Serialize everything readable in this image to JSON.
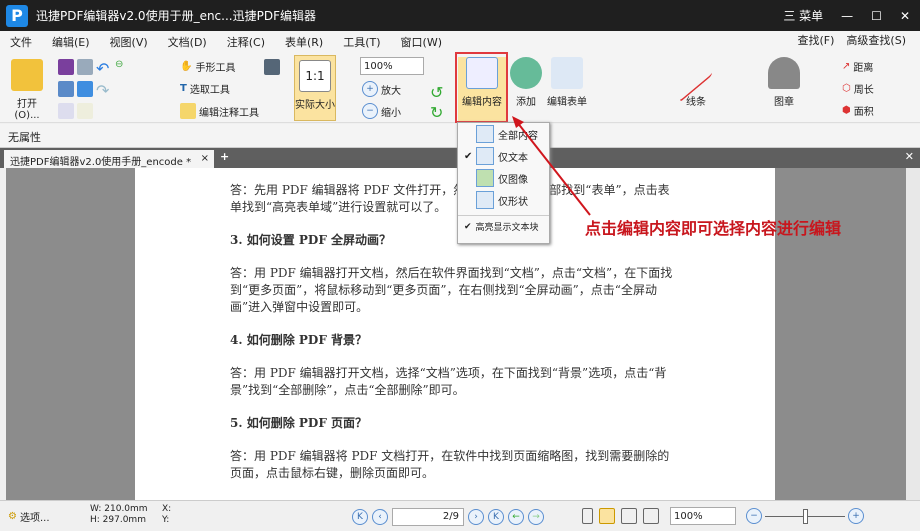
{
  "title": {
    "logo": "P",
    "text": "迅捷PDF编辑器v2.0使用于册_enc...迅捷PDF编辑器",
    "menu": "三 菜单",
    "minimize": "—",
    "maximize": "☐",
    "close": "✕"
  },
  "menubar": [
    "文件",
    "编辑(E)",
    "视图(V)",
    "文档(D)",
    "注释(C)",
    "表单(R)",
    "工具(T)",
    "窗口(W)"
  ],
  "search": {
    "find": "查找(F)",
    "advanced": "高级查找(S)"
  },
  "toolbar": {
    "open": "打开(O)...",
    "hand": "手形工具",
    "select": "选取工具",
    "annot": "编辑注释工具",
    "actual": "实际大小",
    "zoom": "100%",
    "zoom_in": "放大",
    "zoom_out": "缩小",
    "edit_content": "编辑内容",
    "add": "添加",
    "edit_form": "编辑表单",
    "lines": "线条",
    "stamp": "图章",
    "distance": "距离",
    "perimeter": "周长",
    "area": "面积"
  },
  "props": "无属性",
  "tab": {
    "label": "迅捷PDF编辑器v2.0使用手册_encode *",
    "close": "×",
    "add": "+"
  },
  "dropdown": [
    {
      "label": "全部内容",
      "checked": false
    },
    {
      "label": "仅文本",
      "checked": true
    },
    {
      "label": "仅图像",
      "checked": false
    },
    {
      "label": "仅形状",
      "checked": false
    }
  ],
  "dropdown_highlight": "高亮显示文本块",
  "annotation": "点击编辑内容即可选择内容进行编辑",
  "page": {
    "p1": "答：先用 PDF 编辑器将 PDF 文件打开，然后在软件界面顶部找到“表单”，点击表单找到“高亮表单域”进行设置就可以了。",
    "h3": "3.  如何设置 PDF 全屏动画？",
    "p3": "答：用 PDF 编辑器打开文档，然后在软件界面找到“文档”，点击“文档”，在下面找到“更多页面”，将鼠标移动到“更多页面”，在右侧找到“全屏动画”，点击“全屏动画”进入弹窗中设置即可。",
    "h4": "4.  如何删除 PDF 背景？",
    "p4": "答：用 PDF 编辑器打开文档，选择“文档”选项，在下面找到“背景”选项，点击“背景”找到“全部删除”，点击“全部删除”即可。",
    "h5": "5.  如何删除 PDF 页面？",
    "p5": "答：用 PDF 编辑器将 PDF 文档打开，在软件中找到页面缩略图，找到需要删除的页面，点击鼠标右键，删除页面即可。"
  },
  "status": {
    "options": "选项...",
    "w": "W: 210.0mm",
    "h": "H: 297.0mm",
    "x": "X:",
    "y": "Y:",
    "page": "2",
    "total": "9",
    "zoom": "100%"
  }
}
